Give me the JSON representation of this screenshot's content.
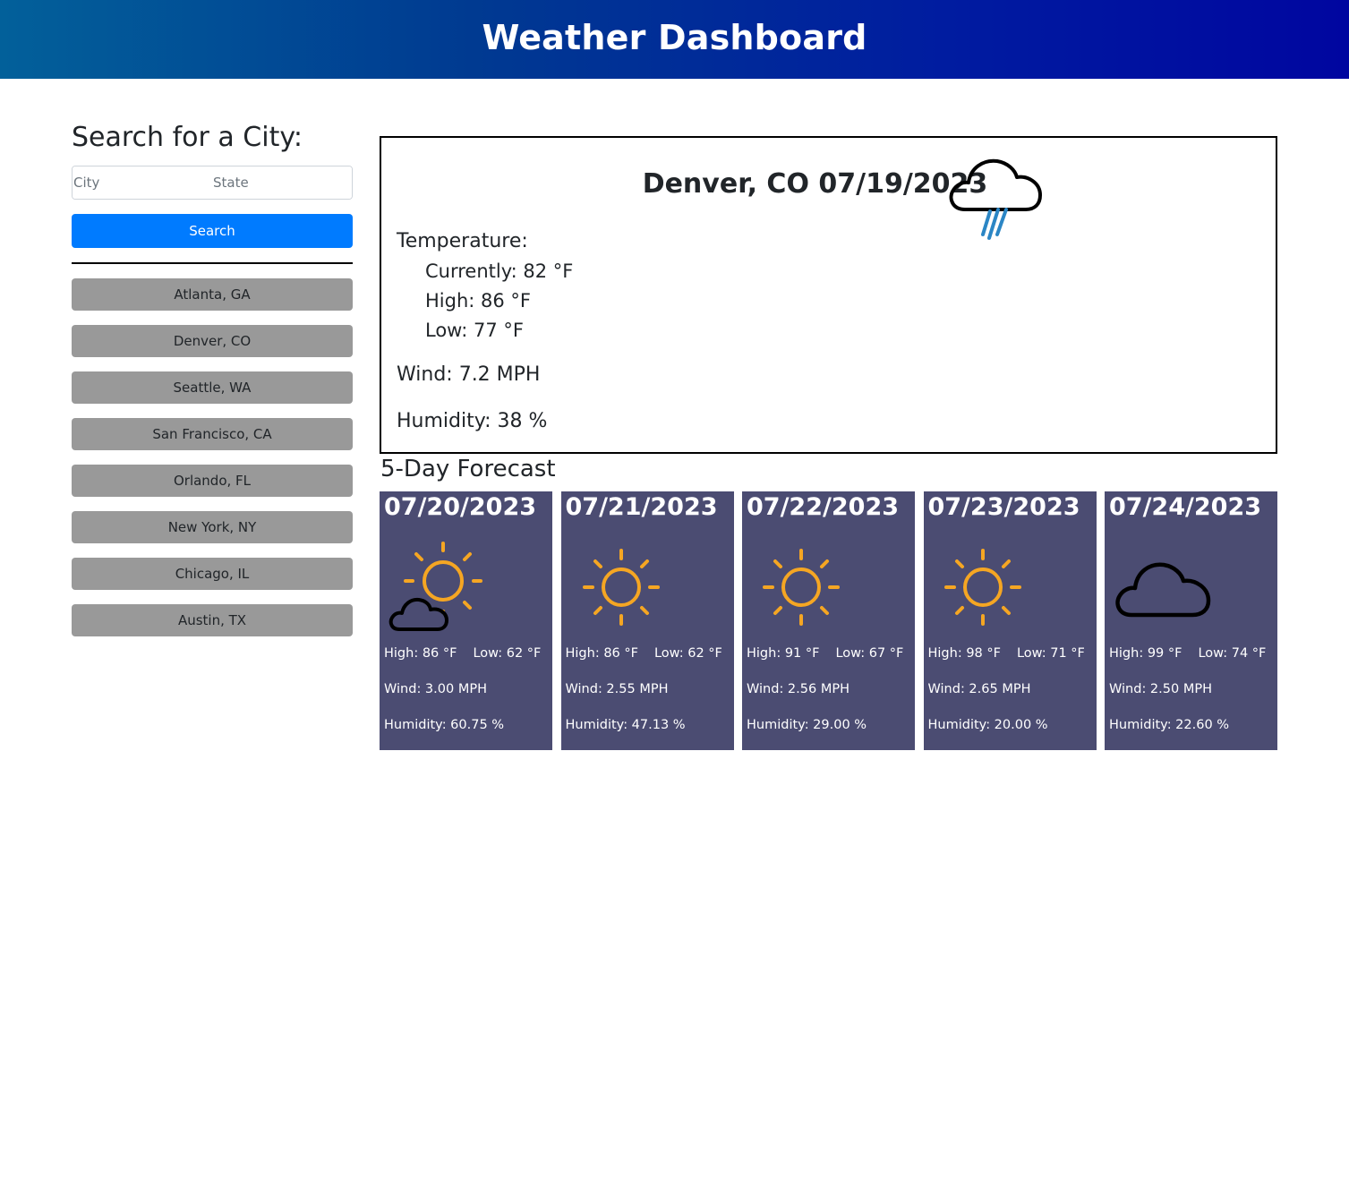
{
  "header": {
    "title": "Weather Dashboard"
  },
  "search": {
    "heading": "Search for a City:",
    "city_placeholder": "City",
    "state_placeholder": "State",
    "button_label": "Search"
  },
  "history": [
    {
      "label": "Atlanta, GA"
    },
    {
      "label": "Denver, CO"
    },
    {
      "label": "Seattle, WA"
    },
    {
      "label": "San Francisco, CA"
    },
    {
      "label": "Orlando, FL"
    },
    {
      "label": "New York, NY"
    },
    {
      "label": "Chicago, IL"
    },
    {
      "label": "Austin, TX"
    }
  ],
  "current": {
    "title": "Denver, CO 07/19/2023",
    "icon": "rain-cloud-icon",
    "temperature_label": "Temperature:",
    "currently": "Currently: 82 °F",
    "high": "High: 86 °F",
    "low": "Low: 77 °F",
    "wind": "Wind: 7.2 MPH",
    "humidity": "Humidity: 38 %"
  },
  "forecast": {
    "title": "5-Day Forecast",
    "days": [
      {
        "date": "07/20/2023",
        "icon": "partly-cloudy-icon",
        "high": "High: 86 °F",
        "low": "Low: 62 °F",
        "wind": "Wind: 3.00 MPH",
        "humidity": "Humidity: 60.75 %"
      },
      {
        "date": "07/21/2023",
        "icon": "sun-icon",
        "high": "High: 86 °F",
        "low": "Low: 62 °F",
        "wind": "Wind: 2.55 MPH",
        "humidity": "Humidity: 47.13 %"
      },
      {
        "date": "07/22/2023",
        "icon": "sun-icon",
        "high": "High: 91 °F",
        "low": "Low: 67 °F",
        "wind": "Wind: 2.56 MPH",
        "humidity": "Humidity: 29.00 %"
      },
      {
        "date": "07/23/2023",
        "icon": "sun-icon",
        "high": "High: 98 °F",
        "low": "Low: 71 °F",
        "wind": "Wind: 2.65 MPH",
        "humidity": "Humidity: 20.00 %"
      },
      {
        "date": "07/24/2023",
        "icon": "cloud-icon",
        "high": "High: 99 °F",
        "low": "Low: 74 °F",
        "wind": "Wind: 2.50 MPH",
        "humidity": "Humidity: 22.60 %"
      }
    ]
  },
  "colors": {
    "header_gradient_start": "#02609a",
    "header_gradient_end": "#0006a0",
    "search_button": "#007bff",
    "history_button": "#999999",
    "forecast_card": "#4b4c72",
    "sun": "#f5a623",
    "rain": "#2b86c5"
  }
}
